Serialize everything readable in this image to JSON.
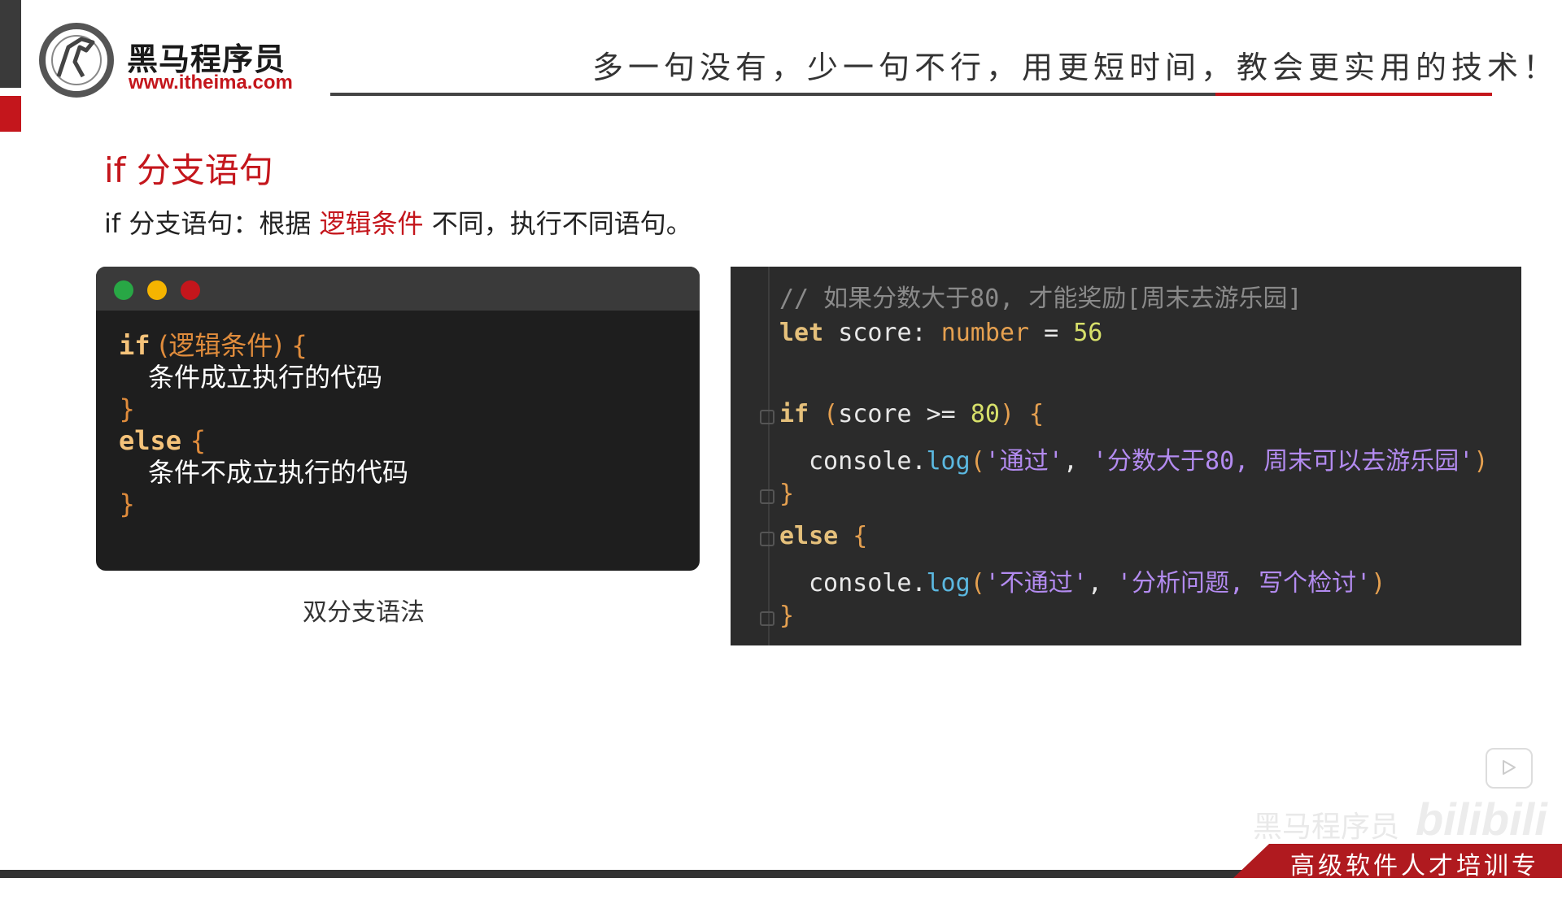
{
  "header": {
    "logo_name": "黑马程序员",
    "logo_url": "www.itheima.com",
    "slogan": "多一句没有，少一句不行，用更短时间，教会更实用的技术！"
  },
  "slide": {
    "title": "if 分支语句",
    "desc_prefix": "if 分支语句：根据",
    "desc_highlight": "逻辑条件",
    "desc_suffix": "不同，执行不同语句。"
  },
  "syntax": {
    "kw_if": "if",
    "cond": "(逻辑条件)",
    "open": "{",
    "body_true": "条件成立执行的代码",
    "close": "}",
    "kw_else": "else",
    "body_false": "条件不成立执行的代码",
    "caption": "双分支语法"
  },
  "code": {
    "comment": "// 如果分数大于80, 才能奖励[周末去游乐园]",
    "kw_let": "let",
    "var_decl": " score: ",
    "type": "number",
    "assign": " = ",
    "init_value": "56",
    "kw_if": "if",
    "if_open_paren": " (",
    "if_cond": "score >= ",
    "if_num": "80",
    "if_close_paren": ")",
    "brace_open": " {",
    "console1": "console",
    "dot": ".",
    "log": "log",
    "paren_open": "(",
    "str_pass": "'通过'",
    "comma": ", ",
    "str_pass_msg": "'分数大于80, 周末可以去游乐园'",
    "paren_close": ")",
    "brace_close": "}",
    "kw_else": "else",
    "str_fail": "'不通过'",
    "str_fail_msg": "'分析问题, 写个检讨'"
  },
  "watermark": {
    "text": "黑马程序员",
    "site": "bilibili"
  },
  "footer": {
    "tagline": "高级软件人才培训专家"
  }
}
